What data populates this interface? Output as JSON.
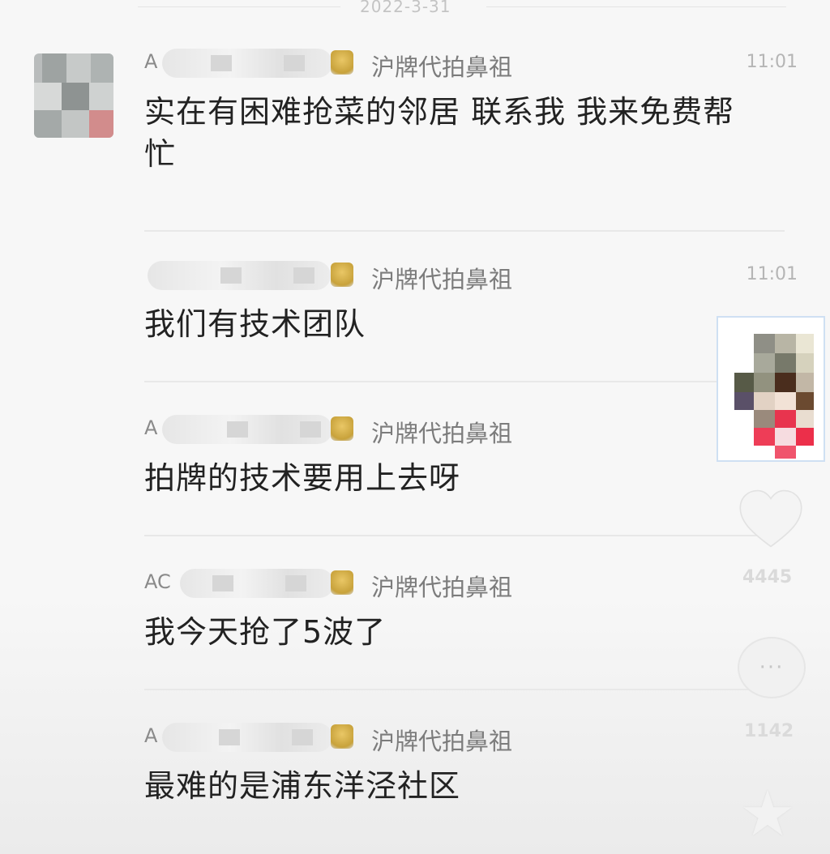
{
  "date": "2022-3-31",
  "messages": [
    {
      "name_prefix": "A",
      "group": "沪牌代拍鼻祖",
      "time": "11:01",
      "text": "实在有困难抢菜的邻居 联系我 我来免费帮忙"
    },
    {
      "name_prefix": "",
      "group": "沪牌代拍鼻祖",
      "time": "11:01",
      "text": "我们有技术团队"
    },
    {
      "name_prefix": "A",
      "group": "沪牌代拍鼻祖",
      "time": "",
      "text": "拍牌的技术要用上去呀"
    },
    {
      "name_prefix": "AC",
      "group": "沪牌代拍鼻祖",
      "time": "",
      "text": "我今天抢了5波了"
    },
    {
      "name_prefix": "A",
      "group": "沪牌代拍鼻祖",
      "time": "",
      "text": "最难的是浦东洋泾社区"
    }
  ],
  "side_actions": {
    "like_count": "4445",
    "comment_icon": "···",
    "comment_count": "1142",
    "star_icon": "★"
  }
}
